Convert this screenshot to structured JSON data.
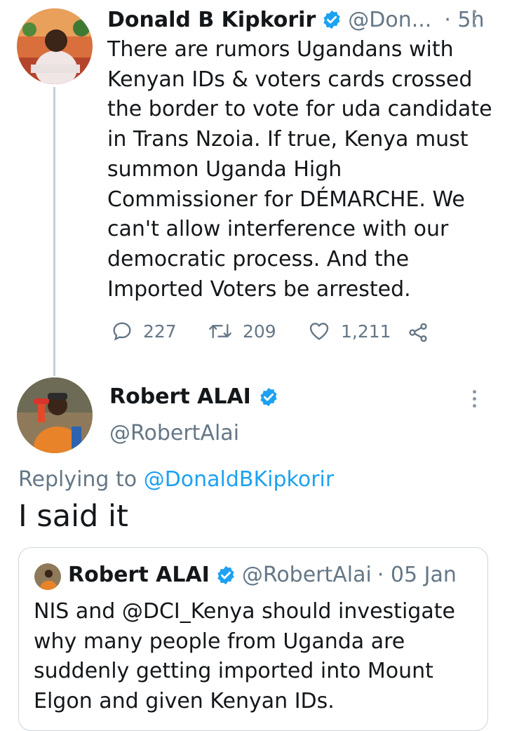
{
  "tweet1": {
    "display_name": "Donald B Kipkorir",
    "handle": "@Don...",
    "time": "· 5h",
    "text_lines": [
      "There are rumors Ugandans with",
      "Kenyan IDs & voters cards crossed",
      "the border to vote for uda candidate",
      "in Trans Nzoia. If true, Kenya must",
      "summon Uganda High",
      "Commissioner for DÉMARCHE. We",
      "can't allow interference with our",
      "democratic process. And the",
      "Imported Voters be arrested."
    ],
    "replies": "227",
    "retweets": "209",
    "likes": "1,211"
  },
  "tweet2": {
    "display_name": "Robert ALAI",
    "handle": "@RobertAlai",
    "replying_prefix": "Replying to",
    "replying_handle": "@DonaldBKipkorir",
    "text": "I said it"
  },
  "quote": {
    "display_name": "Robert ALAI",
    "handle": "@RobertAlai",
    "date": "· 05 Jan",
    "text_lines": [
      "NIS and @DCI_Kenya should investigate",
      "why many people from Uganda are",
      "suddenly getting imported into Mount",
      "Elgon and given Kenyan IDs."
    ]
  },
  "colors": {
    "link": "#1da1f2",
    "verified": "#1da1f2",
    "muted": "#657786",
    "thread_line": "#c4cfd6"
  },
  "icons": [
    "reply-icon",
    "retweet-icon",
    "like-icon",
    "share-icon",
    "verified-badge-icon",
    "more-options-icon"
  ]
}
